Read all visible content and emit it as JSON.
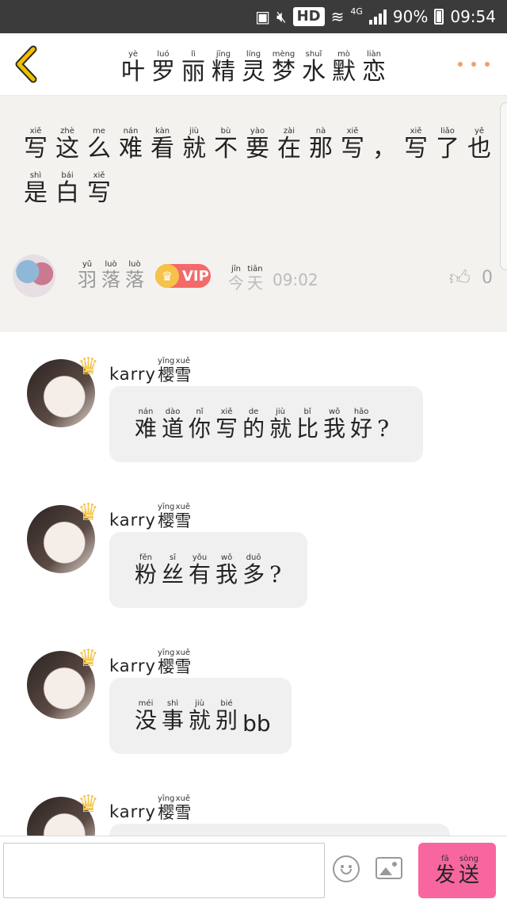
{
  "status_bar": {
    "hd_label": "HD",
    "network_label": "4G",
    "battery_percent": "90%",
    "time": "09:54",
    "icons": [
      "storage-icon",
      "mute-icon",
      "wifi-icon",
      "signal-icon",
      "battery-icon"
    ]
  },
  "header": {
    "title": [
      {
        "py": "yè",
        "hz": "叶"
      },
      {
        "py": "luó",
        "hz": "罗"
      },
      {
        "py": "lì",
        "hz": "丽"
      },
      {
        "py": "jīng",
        "hz": "精"
      },
      {
        "py": "líng",
        "hz": "灵"
      },
      {
        "py": "mèng",
        "hz": "梦"
      },
      {
        "py": "shuǐ",
        "hz": "水"
      },
      {
        "py": "mò",
        "hz": "默"
      },
      {
        "py": "liàn",
        "hz": "恋"
      }
    ],
    "back_icon": "chevron-left-icon",
    "more_icon": "more-dots-icon",
    "accent_color": "#f0c000"
  },
  "post": {
    "text": [
      {
        "py": "xiě",
        "hz": "写"
      },
      {
        "py": "zhè",
        "hz": "这"
      },
      {
        "py": "me",
        "hz": "么"
      },
      {
        "py": "nán",
        "hz": "难"
      },
      {
        "py": "kàn",
        "hz": "看"
      },
      {
        "py": "jiù",
        "hz": "就"
      },
      {
        "py": "bù",
        "hz": "不"
      },
      {
        "py": "yào",
        "hz": "要"
      },
      {
        "py": "zài",
        "hz": "在"
      },
      {
        "py": "nà",
        "hz": "那"
      },
      {
        "py": "xiě",
        "hz": "写"
      },
      {
        "py": "",
        "hz": "，"
      },
      {
        "py": "xiě",
        "hz": "写"
      },
      {
        "py": "liǎo",
        "hz": "了"
      },
      {
        "py": "yě",
        "hz": "也"
      },
      {
        "py": "shì",
        "hz": "是"
      },
      {
        "py": "bái",
        "hz": "白"
      },
      {
        "py": "xiě",
        "hz": "写"
      }
    ],
    "author": [
      {
        "py": "yǔ",
        "hz": "羽"
      },
      {
        "py": "luò",
        "hz": "落"
      },
      {
        "py": "luò",
        "hz": "落"
      }
    ],
    "vip_label": "VIP",
    "date": [
      {
        "py": "jīn",
        "hz": "今"
      },
      {
        "py": "tiān",
        "hz": "天"
      }
    ],
    "time": "09:02",
    "likes": "0",
    "like_icon": "thumbs-up-icon"
  },
  "comments": [
    {
      "name_latin": "karry",
      "name": [
        {
          "py": "yīng",
          "hz": "樱"
        },
        {
          "py": "xuě",
          "hz": "雪"
        }
      ],
      "text": [
        {
          "py": "nán",
          "hz": "难"
        },
        {
          "py": "dào",
          "hz": "道"
        },
        {
          "py": "nǐ",
          "hz": "你"
        },
        {
          "py": "xiě",
          "hz": "写"
        },
        {
          "py": "de",
          "hz": "的"
        },
        {
          "py": "jiù",
          "hz": "就"
        },
        {
          "py": "bǐ",
          "hz": "比"
        },
        {
          "py": "wǒ",
          "hz": "我"
        },
        {
          "py": "hǎo",
          "hz": "好"
        },
        {
          "py": "",
          "hz": "?"
        }
      ],
      "suffix": ""
    },
    {
      "name_latin": "karry",
      "name": [
        {
          "py": "yīng",
          "hz": "樱"
        },
        {
          "py": "xuě",
          "hz": "雪"
        }
      ],
      "text": [
        {
          "py": "fěn",
          "hz": "粉"
        },
        {
          "py": "sī",
          "hz": "丝"
        },
        {
          "py": "yǒu",
          "hz": "有"
        },
        {
          "py": "wǒ",
          "hz": "我"
        },
        {
          "py": "duō",
          "hz": "多"
        },
        {
          "py": "",
          "hz": "?"
        }
      ],
      "suffix": ""
    },
    {
      "name_latin": "karry",
      "name": [
        {
          "py": "yīng",
          "hz": "樱"
        },
        {
          "py": "xuě",
          "hz": "雪"
        }
      ],
      "text": [
        {
          "py": "méi",
          "hz": "没"
        },
        {
          "py": "shì",
          "hz": "事"
        },
        {
          "py": "jiù",
          "hz": "就"
        },
        {
          "py": "bié",
          "hz": "别"
        }
      ],
      "suffix": "bb"
    },
    {
      "name_latin": "karry",
      "name": [
        {
          "py": "yīng",
          "hz": "樱"
        },
        {
          "py": "xuě",
          "hz": "雪"
        }
      ],
      "text": [],
      "suffix": ""
    }
  ],
  "composer": {
    "input_value": "",
    "emoji_icon": "smiley-icon",
    "image_icon": "image-icon",
    "send": [
      {
        "py": "fā",
        "hz": "发"
      },
      {
        "py": "sòng",
        "hz": "送"
      }
    ],
    "send_color": "#f7669e"
  }
}
